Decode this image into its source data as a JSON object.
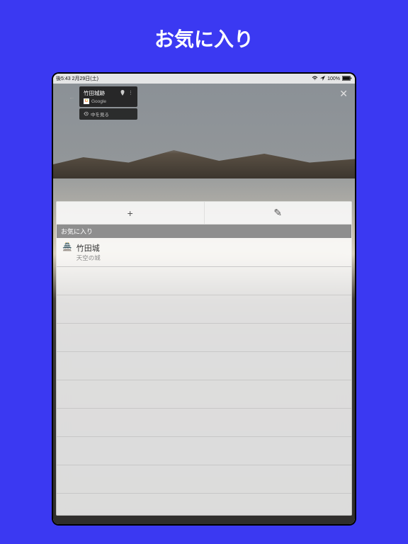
{
  "page": {
    "title": "お気に入り"
  },
  "status": {
    "time": "後5:43",
    "date": "2月29日(土)",
    "battery": "100%"
  },
  "streetview": {
    "place_name": "竹田城跡",
    "provider": "Google",
    "sub_action": "中を見る"
  },
  "toolbar": {
    "add_glyph": "+",
    "edit_glyph": "✎"
  },
  "favorites": {
    "section_label": "お気に入り",
    "items": [
      {
        "emoji": "🏯",
        "title": "竹田城",
        "subtitle": "天空の城"
      }
    ]
  },
  "footer": {
    "attribution": ""
  }
}
